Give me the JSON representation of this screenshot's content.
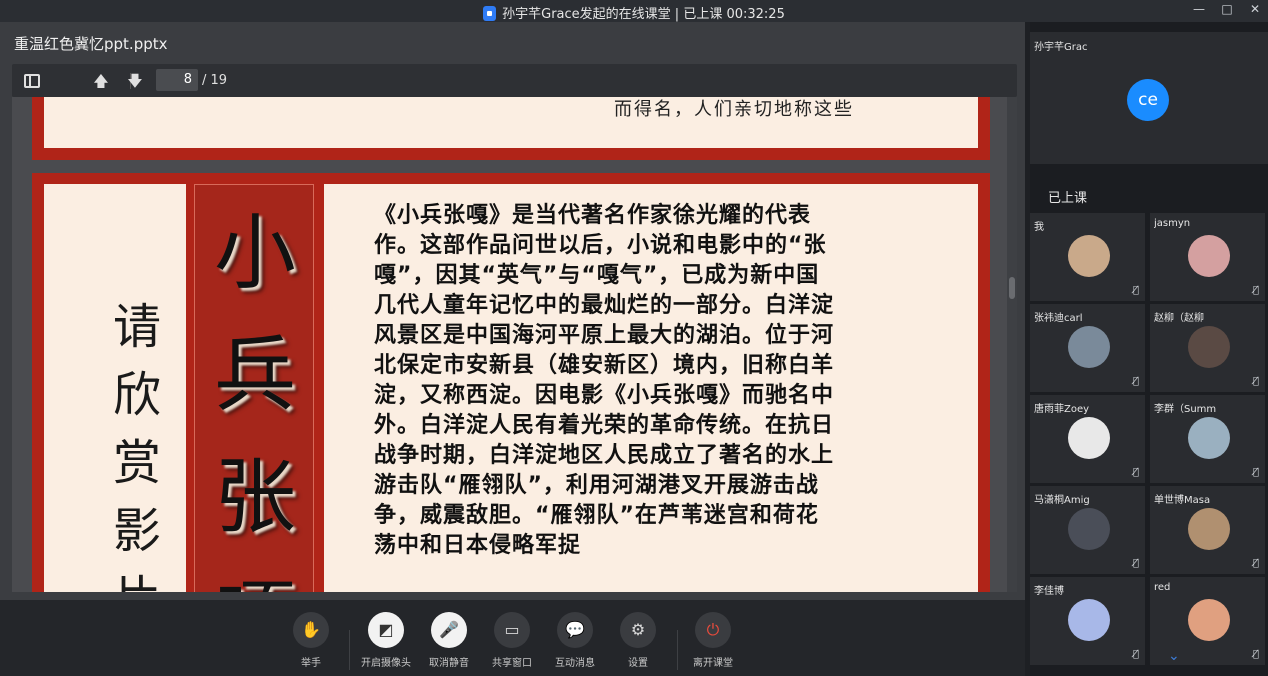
{
  "window": {
    "title": "孙宇芊Grace发起的在线课堂 | 已上课 00:32:25",
    "controls": [
      "minimize-icon",
      "maximize-icon",
      "close-icon"
    ]
  },
  "document": {
    "file_name": "重温红色冀忆ppt.pptx",
    "current_page": "8",
    "total_pages": "/ 19",
    "toolbar_icons": [
      "sidebar-icon",
      "arrow-up-icon",
      "arrow-down-icon"
    ]
  },
  "slide": {
    "prev_cut_text": "而得名，人们亲切地称这些",
    "vertical_small": "请欣赏影片",
    "vertical_big": "小兵张嘎",
    "body": "《小兵张嘎》是当代著名作家徐光耀的代表作。这部作品问世以后，小说和电影中的“张嘎”，因其“英气”与“嘎气”，已成为新中国几代人童年记忆中的最灿烂的一部分。白洋淀风景区是中国海河平原上最大的湖泊。位于河北保定市安新县（雄安新区）境内，旧称白羊淀，又称西淀。因电影《小兵张嘎》而驰名中外。白洋淀人民有着光荣的革命传统。在抗日战争时期，白洋淀地区人民成立了著名的水上游击队“雁翎队”，利用河湖港叉开展游击战争，威震敌胆。“雁翎队”在芦苇迷宫和荷花荡中和日本侵略军捉"
  },
  "controls": [
    {
      "label": "举手",
      "icon": "hand-icon"
    },
    {
      "label": "开启摄像头",
      "icon": "camera-off-icon"
    },
    {
      "label": "取消静音",
      "icon": "mic-off-icon"
    },
    {
      "label": "共享窗口",
      "icon": "screen-share-icon"
    },
    {
      "label": "互动消息",
      "icon": "chat-icon"
    },
    {
      "label": "设置",
      "icon": "gear-icon"
    },
    {
      "label": "离开课堂",
      "icon": "power-icon"
    }
  ],
  "host": {
    "name": "孙宇芊Grac",
    "avatar_text": "ce",
    "avatar_color": "#1a8cff"
  },
  "section_label": "已上课",
  "participants": [
    {
      "name": "我",
      "color": "#c9a98a"
    },
    {
      "name": "jasmyn",
      "color": "#d4a0a0"
    },
    {
      "name": "张祎迪carl",
      "color": "#7a8a9a"
    },
    {
      "name": "赵柳（赵柳",
      "color": "#5a4a44"
    },
    {
      "name": "唐雨菲Zoey",
      "color": "#e8e8e8"
    },
    {
      "name": "李群（Summ",
      "color": "#9ab0c0"
    },
    {
      "name": "马潇桐Amig",
      "color": "#4a4e58"
    },
    {
      "name": "单世博Masa",
      "color": "#b09070"
    },
    {
      "name": "李佳博",
      "color": "#a8b8e8"
    },
    {
      "name": "red",
      "color": "#e0a080"
    }
  ]
}
